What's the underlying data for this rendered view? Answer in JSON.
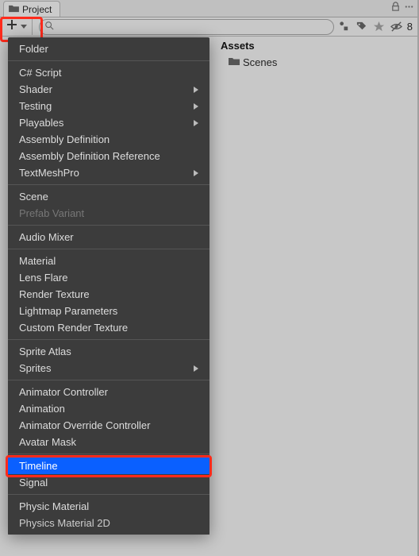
{
  "tab": {
    "title": "Project"
  },
  "toolbar": {
    "search_placeholder": "",
    "count": "8"
  },
  "assets_panel": {
    "header": "Assets",
    "item0": "Scenes"
  },
  "menu": {
    "folder": "Folder",
    "csharp": "C# Script",
    "shader": "Shader",
    "testing": "Testing",
    "playables": "Playables",
    "asmdef": "Assembly Definition",
    "asmref": "Assembly Definition Reference",
    "tmp": "TextMeshPro",
    "scene": "Scene",
    "prefab_variant": "Prefab Variant",
    "audio_mixer": "Audio Mixer",
    "material": "Material",
    "lens_flare": "Lens Flare",
    "render_texture": "Render Texture",
    "lightmap": "Lightmap Parameters",
    "custom_rt": "Custom Render Texture",
    "sprite_atlas": "Sprite Atlas",
    "sprites": "Sprites",
    "anim_controller": "Animator Controller",
    "animation": "Animation",
    "anim_override": "Animator Override Controller",
    "avatar_mask": "Avatar Mask",
    "timeline": "Timeline",
    "signal": "Signal",
    "physic_material": "Physic Material",
    "physics_material_2d": "Physics Material 2D"
  }
}
